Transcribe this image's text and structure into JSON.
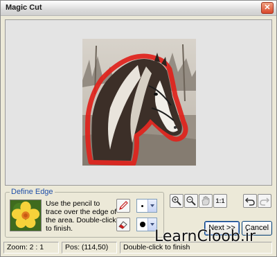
{
  "window": {
    "title": "Magic Cut"
  },
  "define_edge": {
    "legend": "Define Edge",
    "instructions": "Use the pencil to trace over the edge of the area. Double-click to finish.",
    "pencil_size_selected": "small-dot",
    "eraser_size_selected": "large-dot"
  },
  "zoom_toolbar": {
    "ratio_label": "1:1"
  },
  "buttons": {
    "next": "Next >>",
    "cancel": "Cancel"
  },
  "status": {
    "zoom": "Zoom: 2 : 1",
    "pos": "Pos: (114,50)",
    "hint": "Double-click to finish"
  },
  "watermark": "LearnCloob.ir",
  "colors": {
    "trace_outline": "#e0221b",
    "legend_text": "#1f4fa8",
    "close_button": "#d9472b"
  }
}
